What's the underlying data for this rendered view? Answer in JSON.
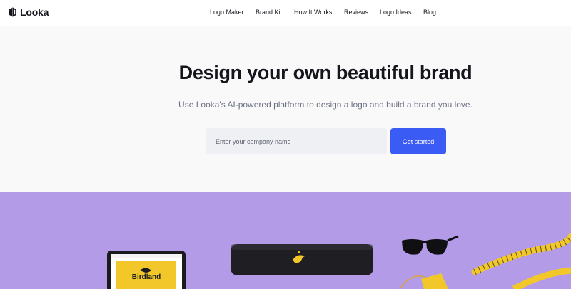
{
  "brand": {
    "name": "Looka",
    "mark_icon": "looka-mark-icon"
  },
  "nav": {
    "items": [
      {
        "label": "Logo Maker"
      },
      {
        "label": "Brand Kit"
      },
      {
        "label": "How It Works"
      },
      {
        "label": "Reviews"
      },
      {
        "label": "Logo Ideas"
      },
      {
        "label": "Blog"
      }
    ]
  },
  "hero": {
    "headline": "Design your own beautiful brand",
    "subhead": "Use Looka's AI-powered platform to design a logo and build a brand you love.",
    "input_placeholder": "Enter your company name",
    "cta_label": "Get started"
  },
  "showcase": {
    "brand_text": "Birdland",
    "background_color": "#b39be8",
    "accent_color": "#f1c72a"
  },
  "colors": {
    "accent": "#3b5bf5",
    "text": "#14161c",
    "muted": "#6b7080"
  }
}
